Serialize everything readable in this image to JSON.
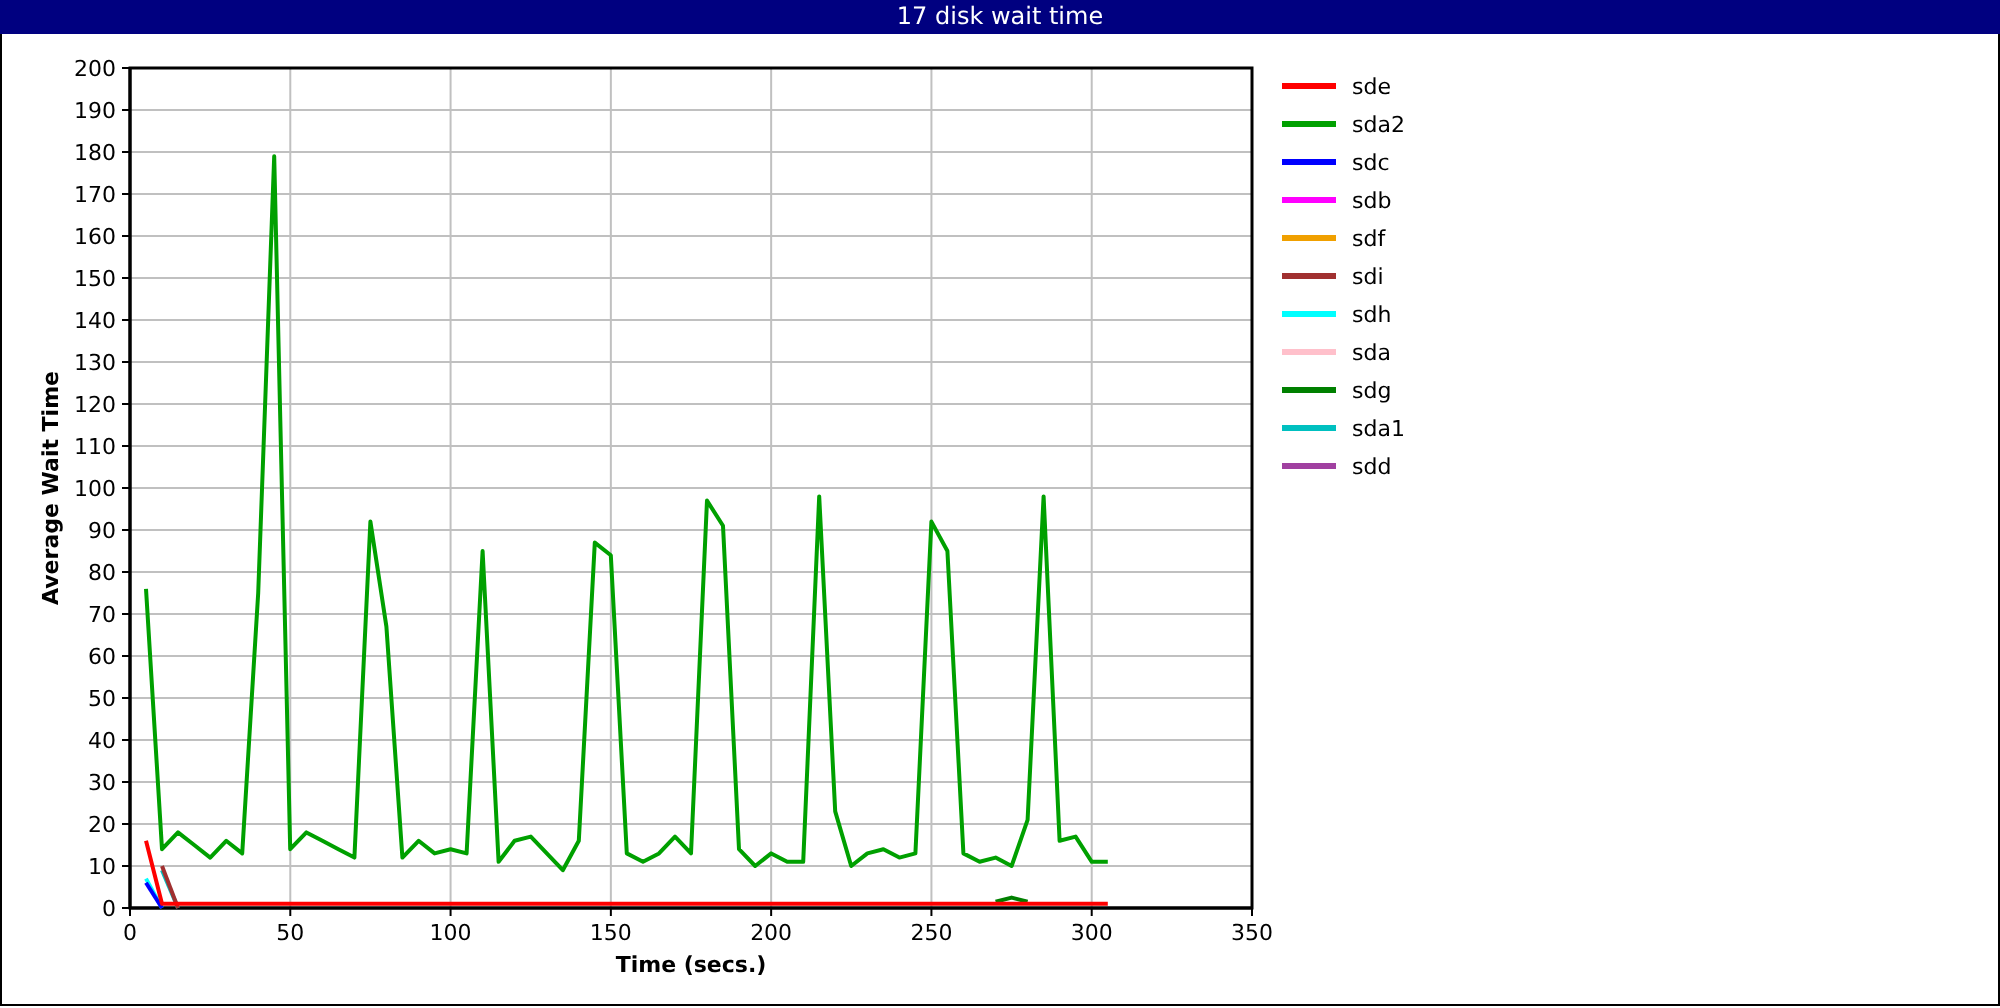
{
  "window": {
    "title": "17 disk wait time"
  },
  "chart": {
    "chart_data": {
      "type": "line",
      "grid": true,
      "legend": true,
      "xlabel": "Time (secs.)",
      "ylabel": "Average Wait Time",
      "xlim": [
        0,
        350
      ],
      "ylim": [
        0,
        200
      ],
      "xticks": [
        0,
        50,
        100,
        150,
        200,
        250,
        300,
        350
      ],
      "yticks": [
        0,
        10,
        20,
        30,
        40,
        50,
        60,
        70,
        80,
        90,
        100,
        110,
        120,
        130,
        140,
        150,
        160,
        170,
        180,
        190,
        200
      ],
      "x": [
        5,
        10,
        15,
        20,
        25,
        30,
        35,
        40,
        45,
        50,
        55,
        60,
        65,
        70,
        75,
        80,
        85,
        90,
        95,
        100,
        105,
        110,
        115,
        120,
        125,
        130,
        135,
        140,
        145,
        150,
        155,
        160,
        165,
        170,
        175,
        180,
        185,
        190,
        195,
        200,
        205,
        210,
        215,
        220,
        225,
        230,
        235,
        240,
        245,
        250,
        255,
        260,
        265,
        270,
        275,
        280,
        285,
        290,
        295,
        300,
        305
      ],
      "series": [
        {
          "name": "sde",
          "color": "#ff0000",
          "values": [
            16,
            1,
            1,
            1,
            1,
            1,
            1,
            1,
            1,
            1,
            1,
            1,
            1,
            1,
            1,
            1,
            1,
            1,
            1,
            1,
            1,
            1,
            1,
            1,
            1,
            1,
            1,
            1,
            1,
            1,
            1,
            1,
            1,
            1,
            1,
            1,
            1,
            1,
            1,
            1,
            1,
            1,
            1,
            1,
            1,
            1,
            1,
            1,
            1,
            1,
            1,
            1,
            1,
            1,
            1,
            1,
            1,
            1,
            1,
            1,
            1
          ]
        },
        {
          "name": "sda2",
          "color": "#00a000",
          "values": [
            76,
            14,
            18,
            15,
            12,
            16,
            13,
            75,
            179,
            14,
            18,
            16,
            14,
            12,
            92,
            67,
            12,
            16,
            13,
            14,
            13,
            85,
            11,
            16,
            17,
            13,
            9,
            16,
            87,
            84,
            13,
            11,
            13,
            17,
            13,
            97,
            91,
            14,
            10,
            13,
            11,
            11,
            98,
            23,
            10,
            13,
            14,
            12,
            13,
            92,
            85,
            13,
            11,
            12,
            10,
            21,
            98,
            16,
            17,
            11,
            11
          ]
        },
        {
          "name": "sdc",
          "color": "#0000ff",
          "values": [
            6,
            0,
            null,
            null,
            null,
            null,
            null,
            null,
            null,
            null,
            null,
            null,
            null,
            null,
            null,
            null,
            null,
            null,
            null,
            null,
            null,
            null,
            null,
            null,
            null,
            null,
            null,
            null,
            null,
            null,
            null,
            null,
            null,
            null,
            null,
            null,
            null,
            null,
            null,
            null,
            null,
            null,
            null,
            null,
            null,
            null,
            null,
            null,
            null,
            null,
            null,
            null,
            null,
            null,
            null,
            null,
            null,
            null,
            null,
            null,
            null
          ]
        },
        {
          "name": "sdb",
          "color": "#ff00ff",
          "values": [
            null,
            null,
            null,
            null,
            null,
            null,
            null,
            null,
            null,
            null,
            null,
            null,
            null,
            null,
            null,
            null,
            null,
            null,
            null,
            null,
            null,
            null,
            null,
            null,
            null,
            null,
            null,
            null,
            null,
            null,
            null,
            null,
            null,
            null,
            null,
            null,
            null,
            null,
            null,
            null,
            null,
            null,
            null,
            null,
            null,
            null,
            null,
            null,
            null,
            null,
            null,
            null,
            null,
            null,
            null,
            null,
            null,
            null,
            null,
            null,
            null
          ]
        },
        {
          "name": "sdf",
          "color": "#f0a000",
          "values": [
            null,
            null,
            null,
            null,
            null,
            null,
            null,
            null,
            null,
            null,
            null,
            null,
            null,
            null,
            null,
            null,
            null,
            null,
            null,
            null,
            null,
            null,
            null,
            null,
            null,
            null,
            null,
            null,
            null,
            null,
            null,
            null,
            null,
            null,
            null,
            null,
            null,
            null,
            null,
            null,
            null,
            null,
            null,
            null,
            null,
            null,
            null,
            null,
            null,
            null,
            null,
            null,
            null,
            null,
            null,
            null,
            null,
            null,
            null,
            null,
            null
          ]
        },
        {
          "name": "sdi",
          "color": "#a03030",
          "values": [
            null,
            10,
            0,
            null,
            null,
            null,
            null,
            null,
            null,
            null,
            null,
            null,
            null,
            null,
            null,
            null,
            null,
            null,
            null,
            null,
            null,
            null,
            null,
            null,
            null,
            null,
            null,
            null,
            null,
            null,
            null,
            null,
            null,
            null,
            null,
            null,
            null,
            null,
            null,
            null,
            null,
            null,
            null,
            null,
            null,
            null,
            null,
            null,
            null,
            null,
            null,
            null,
            null,
            null,
            null,
            null,
            null,
            null,
            null,
            null,
            null
          ]
        },
        {
          "name": "sdh",
          "color": "#00ffff",
          "values": [
            7,
            0,
            null,
            null,
            null,
            null,
            null,
            null,
            null,
            null,
            null,
            null,
            null,
            null,
            null,
            null,
            null,
            null,
            null,
            null,
            null,
            null,
            null,
            null,
            null,
            null,
            null,
            null,
            null,
            null,
            null,
            null,
            null,
            null,
            null,
            null,
            null,
            null,
            null,
            null,
            null,
            null,
            null,
            null,
            null,
            null,
            null,
            null,
            null,
            null,
            null,
            null,
            null,
            null,
            null,
            null,
            null,
            null,
            null,
            null,
            null
          ]
        },
        {
          "name": "sda",
          "color": "#ffc0cb",
          "values": [
            null,
            null,
            null,
            null,
            null,
            null,
            null,
            null,
            null,
            null,
            null,
            null,
            null,
            null,
            null,
            null,
            null,
            null,
            null,
            null,
            null,
            null,
            null,
            null,
            null,
            null,
            null,
            null,
            null,
            null,
            null,
            null,
            null,
            null,
            null,
            null,
            null,
            null,
            null,
            null,
            null,
            null,
            null,
            null,
            null,
            null,
            null,
            null,
            null,
            null,
            null,
            null,
            null,
            null,
            null,
            null,
            null,
            null,
            null,
            null,
            null
          ]
        },
        {
          "name": "sdg",
          "color": "#008000",
          "values": [
            null,
            null,
            null,
            null,
            null,
            null,
            null,
            null,
            null,
            null,
            null,
            null,
            null,
            null,
            null,
            null,
            null,
            null,
            null,
            null,
            null,
            null,
            null,
            null,
            null,
            null,
            null,
            null,
            null,
            null,
            null,
            null,
            null,
            null,
            null,
            null,
            null,
            null,
            null,
            null,
            null,
            null,
            null,
            null,
            null,
            null,
            null,
            null,
            null,
            null,
            null,
            null,
            null,
            1.5,
            2.5,
            1.5,
            null,
            null,
            null,
            null,
            null
          ]
        },
        {
          "name": "sda1",
          "color": "#00c0c0",
          "values": [
            null,
            9,
            0,
            null,
            null,
            null,
            null,
            null,
            null,
            null,
            null,
            null,
            null,
            null,
            null,
            null,
            null,
            null,
            null,
            null,
            null,
            null,
            null,
            null,
            null,
            null,
            null,
            null,
            null,
            null,
            null,
            null,
            null,
            null,
            null,
            null,
            null,
            null,
            null,
            null,
            null,
            null,
            null,
            null,
            null,
            null,
            null,
            null,
            null,
            null,
            null,
            null,
            null,
            null,
            null,
            null,
            null,
            null,
            null,
            null,
            null
          ]
        },
        {
          "name": "sdd",
          "color": "#a040a0",
          "values": [
            null,
            null,
            null,
            null,
            null,
            null,
            null,
            null,
            null,
            null,
            null,
            null,
            null,
            null,
            null,
            null,
            null,
            null,
            null,
            null,
            null,
            null,
            null,
            null,
            null,
            null,
            null,
            null,
            null,
            null,
            null,
            null,
            null,
            null,
            null,
            null,
            null,
            null,
            null,
            null,
            null,
            null,
            null,
            null,
            null,
            null,
            null,
            null,
            null,
            null,
            null,
            null,
            null,
            null,
            null,
            null,
            null,
            null,
            null,
            null,
            null
          ]
        }
      ]
    }
  }
}
